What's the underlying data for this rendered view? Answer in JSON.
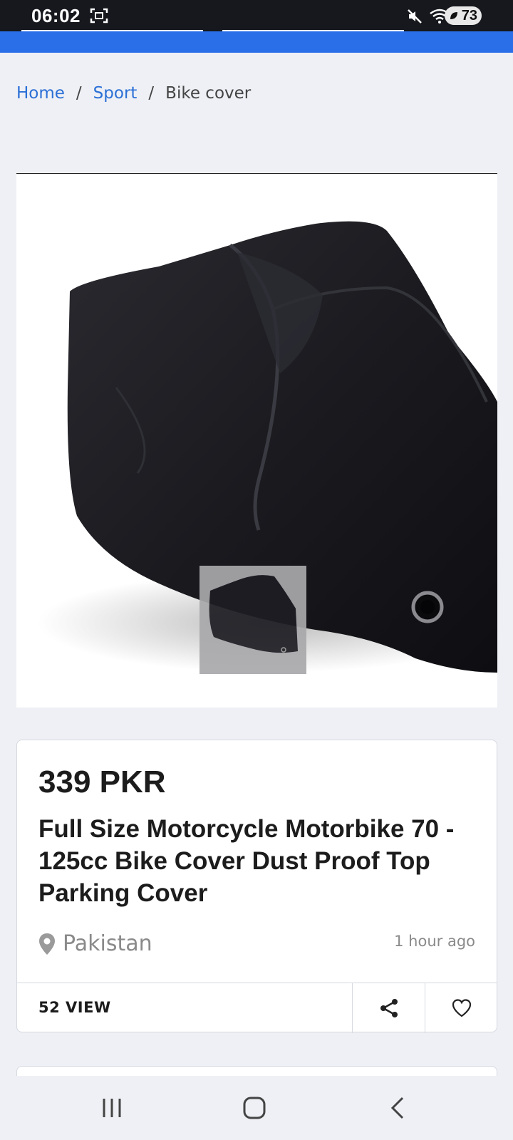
{
  "status_bar": {
    "time": "06:02",
    "battery": "73",
    "icons": [
      "screenshot-icon",
      "mute-icon",
      "wifi-icon",
      "signal-icon",
      "battery-icon"
    ]
  },
  "breadcrumb": {
    "items": [
      "Home",
      "Sport",
      "Bike cover"
    ],
    "separator": "/"
  },
  "listing": {
    "image_alt": "Bike cover",
    "price": "339 PKR",
    "title": "Full Size Motorcycle Motorbike 70 - 125cc Bike Cover Dust Proof Top Parking Cover",
    "location": "Pakistan",
    "posted": "1 hour ago",
    "views": "52 VIEW",
    "icons": [
      "location-pin-icon",
      "share-icon",
      "heart-icon"
    ]
  },
  "colors": {
    "accent": "#2a6fe8",
    "link": "#2b6fd6",
    "background": "#eef0f5"
  },
  "nav": {
    "icons": [
      "recent-apps-icon",
      "home-icon",
      "back-icon"
    ]
  }
}
